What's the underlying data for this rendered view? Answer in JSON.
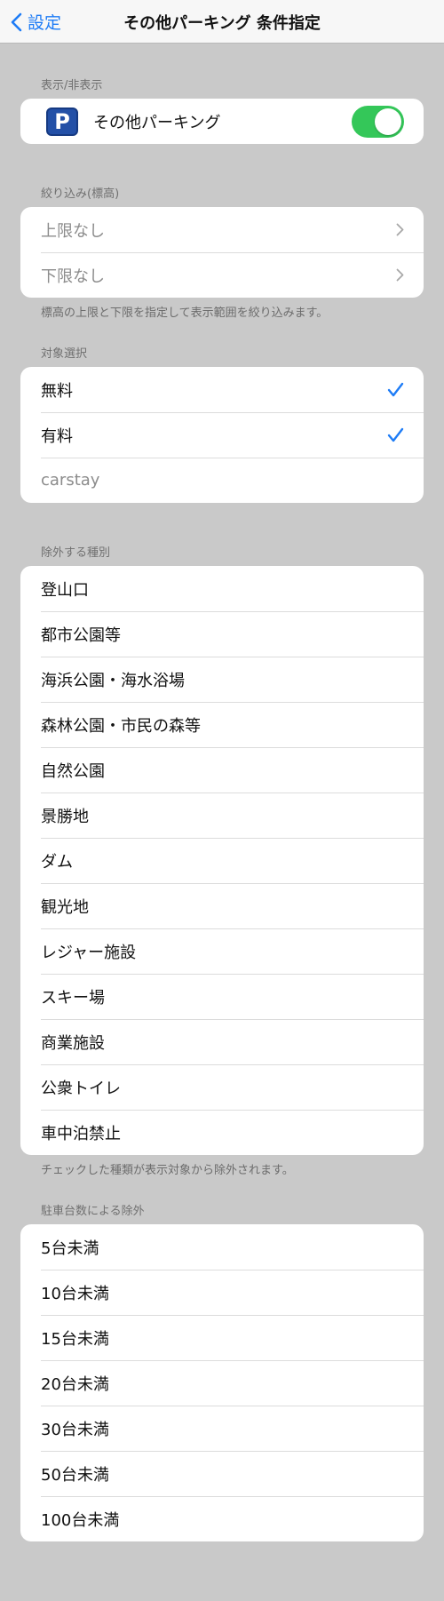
{
  "nav": {
    "back_label": "設定",
    "title": "その他パーキング 条件指定"
  },
  "display": {
    "header": "表示/非表示",
    "icon_letter": "P",
    "label": "その他パーキング",
    "toggle_on": true
  },
  "elevation": {
    "header": "絞り込み(標高)",
    "items": [
      {
        "label": "上限なし"
      },
      {
        "label": "下限なし"
      }
    ],
    "footer": "標高の上限と下限を指定して表示範囲を絞り込みます。"
  },
  "target": {
    "header": "対象選択",
    "items": [
      {
        "label": "無料",
        "checked": true
      },
      {
        "label": "有料",
        "checked": true
      },
      {
        "label": "carstay",
        "checked": false
      }
    ]
  },
  "exclude_types": {
    "header": "除外する種別",
    "items": [
      {
        "label": "登山口"
      },
      {
        "label": "都市公園等"
      },
      {
        "label": "海浜公園・海水浴場"
      },
      {
        "label": "森林公園・市民の森等"
      },
      {
        "label": "自然公園"
      },
      {
        "label": "景勝地"
      },
      {
        "label": "ダム"
      },
      {
        "label": "観光地"
      },
      {
        "label": "レジャー施設"
      },
      {
        "label": "スキー場"
      },
      {
        "label": "商業施設"
      },
      {
        "label": "公衆トイレ"
      },
      {
        "label": "車中泊禁止"
      }
    ],
    "footer": "チェックした種類が表示対象から除外されます。"
  },
  "exclude_capacity": {
    "header": "駐車台数による除外",
    "items": [
      {
        "label": "5台未満"
      },
      {
        "label": "10台未満"
      },
      {
        "label": "15台未満"
      },
      {
        "label": "20台未満"
      },
      {
        "label": "30台未満"
      },
      {
        "label": "50台未満"
      },
      {
        "label": "100台未満"
      }
    ]
  },
  "colors": {
    "accent": "#1e7cf6",
    "toggle_on": "#34c759",
    "background": "#c9c9c9",
    "icon_bg": "#2350a7"
  },
  "icons": {
    "back": "chevron-left-icon",
    "parking": "parking-icon",
    "disclosure": "chevron-right-icon",
    "check": "checkmark-icon"
  }
}
